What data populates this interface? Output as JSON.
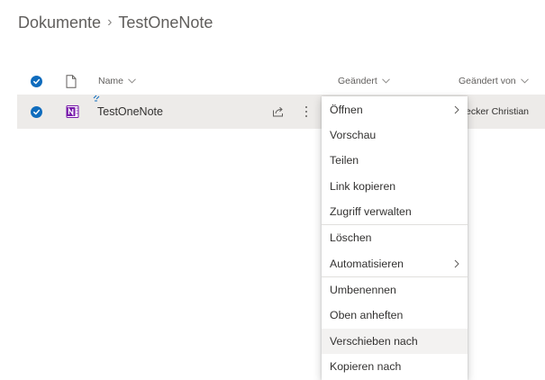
{
  "breadcrumb": {
    "root": "Dokumente",
    "separator": "›",
    "current": "TestOneNote"
  },
  "columns": {
    "name": "Name",
    "modified": "Geändert",
    "modified_by": "Geändert von"
  },
  "file": {
    "name": "TestOneNote",
    "modified_by_partial": "ecker Christian",
    "selected": true
  },
  "menu": {
    "items": [
      {
        "label": "Öffnen",
        "submenu": true
      },
      {
        "label": "Vorschau"
      },
      {
        "label": "Teilen"
      },
      {
        "label": "Link kopieren"
      },
      {
        "label": "Zugriff verwalten"
      },
      {
        "label": "Löschen"
      },
      {
        "label": "Automatisieren",
        "submenu": true
      },
      {
        "label": "Umbenennen"
      },
      {
        "label": "Oben anheften"
      },
      {
        "label": "Verschieben nach",
        "hovered": true
      },
      {
        "label": "Kopieren nach"
      }
    ]
  },
  "colors": {
    "accent": "#0f6cbd",
    "onenote": "#7719aa",
    "row_selected": "#edebe9",
    "hover": "#f3f2f1"
  },
  "icons": [
    "checkmark-icon",
    "document-icon",
    "chevron-down-icon",
    "onenote-icon",
    "share-icon",
    "more-icon",
    "chevron-right-icon"
  ]
}
